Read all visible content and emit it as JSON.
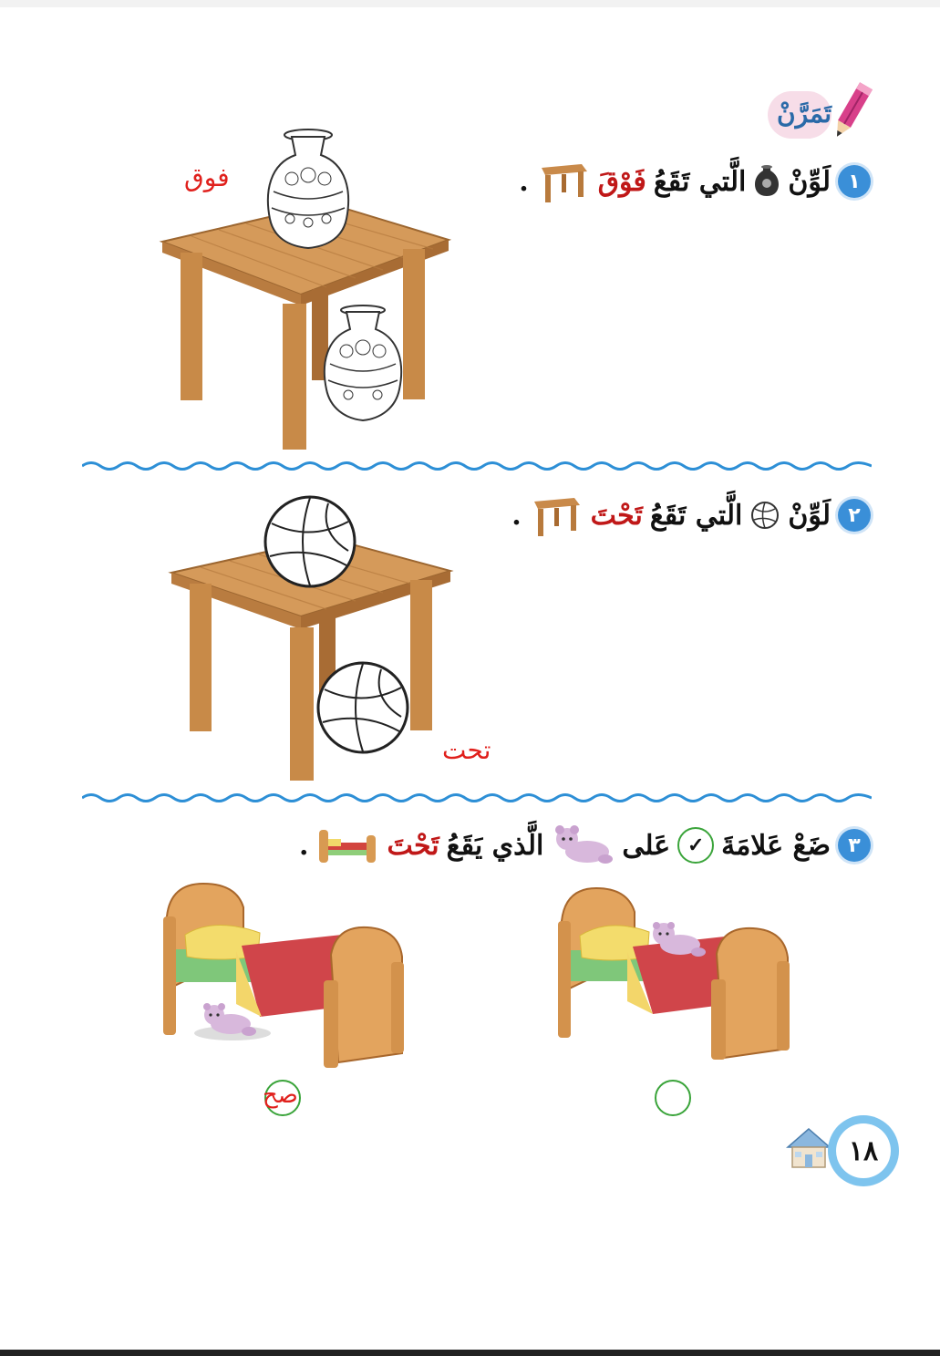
{
  "header": {
    "title": "تَمَرَّنْ",
    "icon": "pencil-icon"
  },
  "q1": {
    "number": "١",
    "verb": "لَوِّنْ",
    "rest": "الَّتي تَقَعُ",
    "keyword": "فَوْقَ",
    "end": ".",
    "answer": "فوق"
  },
  "q2": {
    "number": "٢",
    "verb": "لَوِّنْ",
    "rest": "الَّتي تَقَعُ",
    "keyword": "تَحْتَ",
    "end": ".",
    "answer": "تحت"
  },
  "q3": {
    "number": "٣",
    "verb": "ضَعْ عَلامَةَ",
    "check": "✓",
    "mid": "عَلى",
    "rest": "الَّذي يَقَعُ",
    "keyword": "تَحْتَ",
    "end": ".",
    "answer": "صح"
  },
  "footer": {
    "page_number": "١٨",
    "icon": "house-icon"
  },
  "colors": {
    "accent_blue": "#3a8fd8",
    "keyword_red": "#c01818",
    "wood": "#c98a4a",
    "answer_red": "#e0201c",
    "circle_green": "#3aa43a"
  }
}
